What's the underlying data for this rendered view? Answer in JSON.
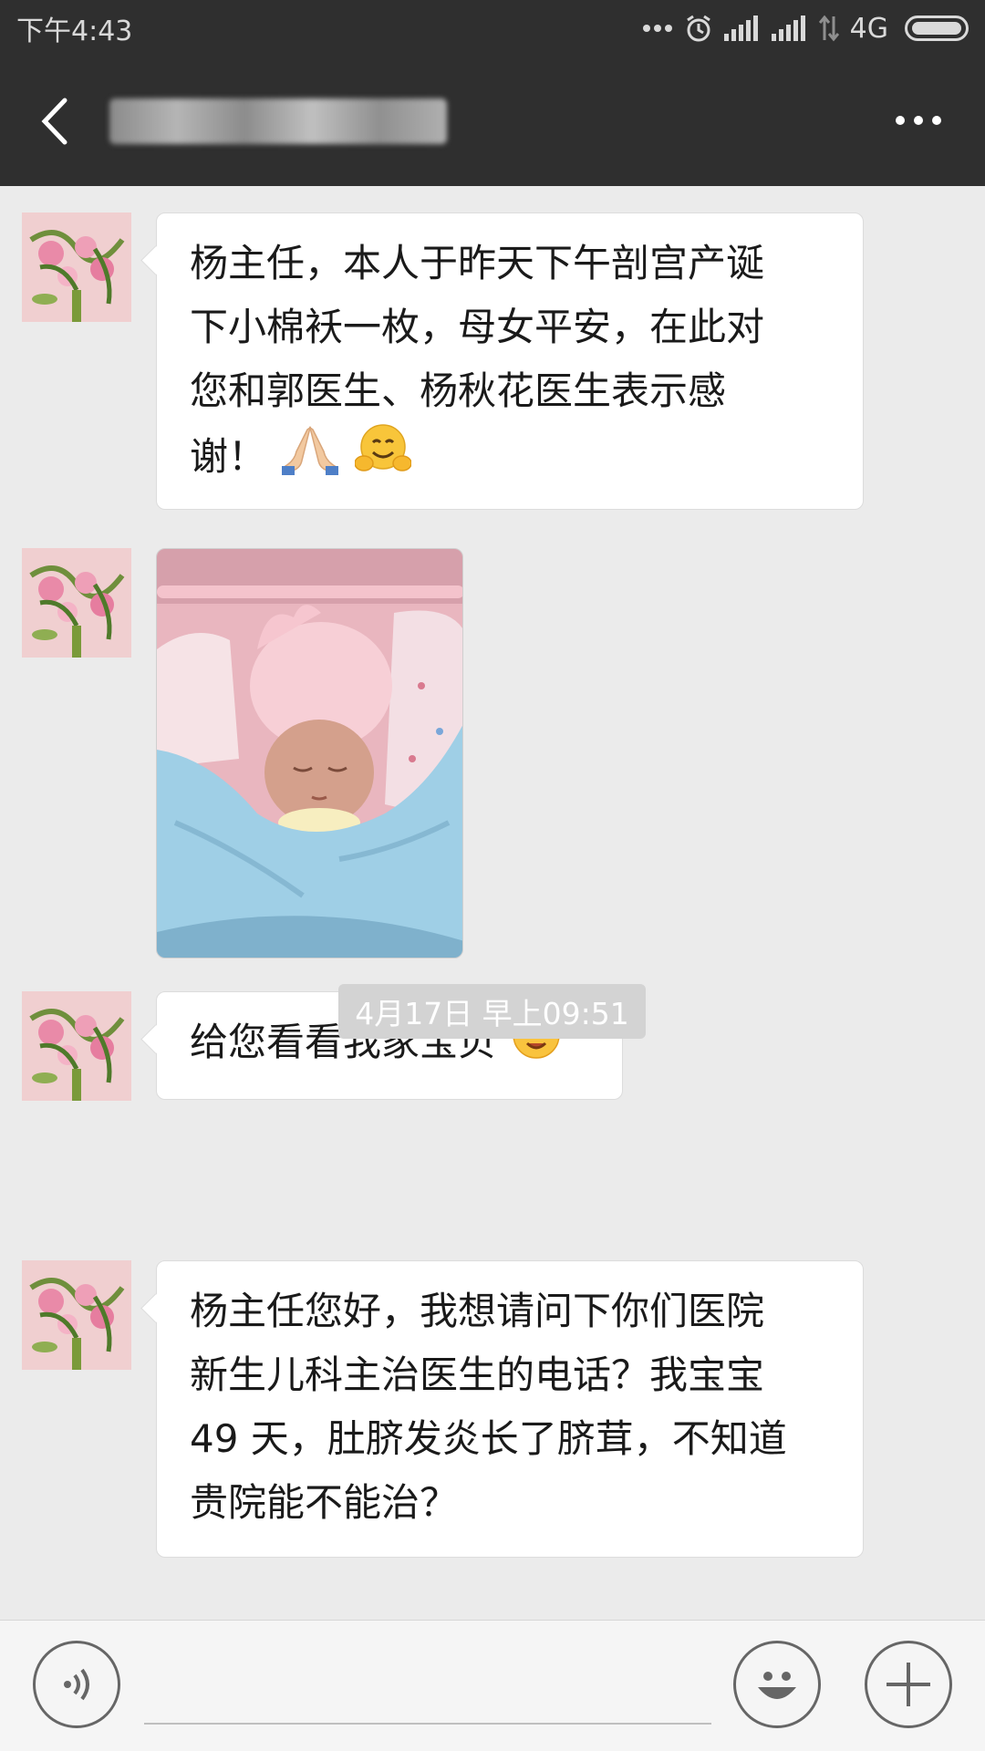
{
  "status_bar": {
    "time": "下午4:43",
    "network": "4G",
    "icons": [
      "more-dots-icon",
      "alarm-icon",
      "signal-icon",
      "signal-icon",
      "data-arrows-icon",
      "battery-icon"
    ]
  },
  "header": {
    "title": "",
    "back_icon": "chevron-left-icon",
    "more_icon": "more-horizontal-icon"
  },
  "messages": [
    {
      "type": "text",
      "lines": [
        "杨主任，本人于昨天下午剖宫产诞",
        "下小棉袄一枚，母女平安，在此对",
        "您和郭医生、杨秋花医生表示感",
        "谢！"
      ],
      "emojis": [
        "folded-hands-emoji",
        "hugging-face-emoji"
      ]
    },
    {
      "type": "image",
      "subject": "newborn-baby-photo"
    },
    {
      "type": "text",
      "lines": [
        "给您看看我家宝贝"
      ],
      "emojis": [
        "star-struck-face-emoji"
      ]
    },
    {
      "type": "timestamp",
      "text": "4月17日 早上09:51"
    },
    {
      "type": "text",
      "lines": [
        "杨主任您好，我想请问下你们医院",
        "新生儿科主治医生的电话？我宝宝",
        "49 天，肚脐发炎长了脐茸，不知道",
        "贵院能不能治？"
      ]
    }
  ],
  "input_bar": {
    "voice_icon": "voice-icon",
    "emoji_icon": "smiley-icon",
    "plus_icon": "plus-icon",
    "input_value": ""
  },
  "colors": {
    "header_bg": "#2f2f2f",
    "chat_bg": "#ebebeb",
    "bubble_bg": "#ffffff",
    "timestamp_bg": "#d3d3d3"
  }
}
